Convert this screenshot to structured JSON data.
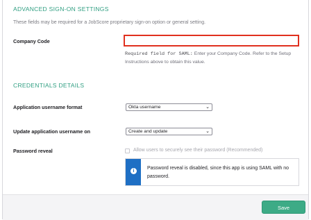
{
  "advanced": {
    "title": "ADVANCED SIGN-ON SETTINGS",
    "description": "These fields may be required for a JobScore proprietary sign-on option or general setting.",
    "company_code_label": "Company Code",
    "company_code_value": "",
    "help_prefix": "Required field for SAML:",
    "help_text": " Enter your Company Code. Refer to the Setup Instructions above to obtain this value."
  },
  "credentials": {
    "title": "CREDENTIALS DETAILS",
    "username_format_label": "Application username format",
    "username_format_value": "Okta username",
    "update_on_label": "Update application username on",
    "update_on_value": "Create and update",
    "password_reveal_label": "Password reveal",
    "password_reveal_checkbox_label": "Allow users to securely see their password (Recommended)",
    "password_reveal_checked": false,
    "info_message": "Password reveal is disabled, since this app is using SAML with no password."
  },
  "footer": {
    "save_label": "Save"
  },
  "colors": {
    "accent": "#2f9e81",
    "error_border": "#e0301e",
    "info_blue": "#1e6fc4",
    "save_green": "#3dab86"
  },
  "icons": {
    "info": "info-icon",
    "chevron": "chevron-down-icon"
  }
}
